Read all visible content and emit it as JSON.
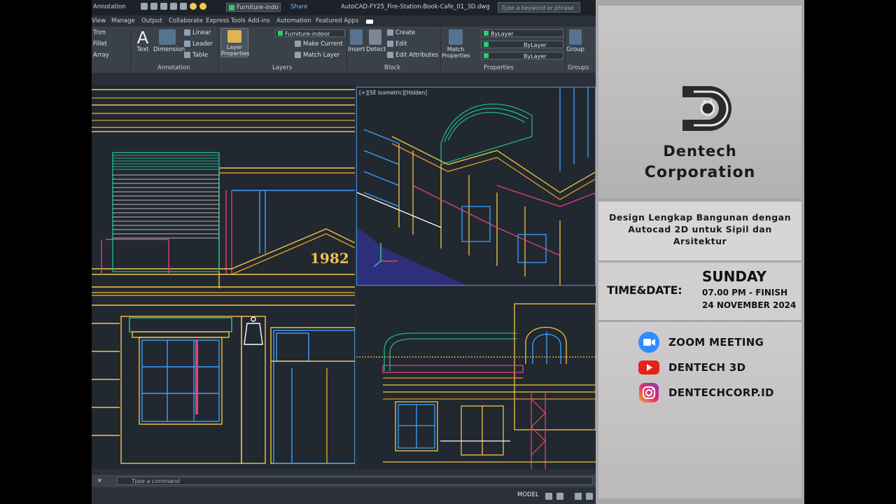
{
  "autocad": {
    "workspace": "Annotation",
    "quick_layer": "Furniture-indo",
    "share_label": "Share",
    "file_title": "AutoCAD-FY25_Fire-Station-Book-Cafe_01_3D.dwg",
    "search_placeholder": "Type a keyword or phrase",
    "tabs": [
      "View",
      "Manage",
      "Output",
      "Collaborate",
      "Express Tools",
      "Add-ins",
      "Automation",
      "Featured Apps"
    ],
    "ribbon": {
      "modify_items": [
        "Trim",
        "Fillet",
        "Array"
      ],
      "annotation_big": [
        "Text",
        "Dimension"
      ],
      "annotation_small": [
        "Linear",
        "Leader",
        "Table"
      ],
      "annotation_label": "Annotation",
      "layer_props": "Layer Properties",
      "layer_current": "Furniture-indoor",
      "layer_tools": [
        "Make Current",
        "Match Layer"
      ],
      "layers_label": "Layers",
      "insert_label": "Insert",
      "detect_label": "Detect",
      "block_tools": [
        "Create",
        "Edit",
        "Edit Attributes"
      ],
      "block_label": "Block",
      "match_props": "Match Properties",
      "bylayer": [
        "ByLayer",
        "ByLayer",
        "ByLayer"
      ],
      "properties_label": "Properties",
      "group_label": "Group",
      "groups_label": "Groups"
    },
    "viewport_label": "[+][SE Isometric][Hidden]",
    "building_year": "1982",
    "command_placeholder": "Type a command",
    "status_model": "MODEL"
  },
  "promo": {
    "company_line1": "Dentech",
    "company_line2": "Corporation",
    "course_title": "Design Lengkap Bangunan dengan Autocad 2D untuk Sipil dan Arsitektur",
    "time_date_label": "TIME&DATE:",
    "day": "SUNDAY",
    "time": "07.00 PM - FINISH",
    "date": "24 NOVEMBER 2024",
    "channels": [
      {
        "icon": "zoom-icon",
        "label": "ZOOM MEETING"
      },
      {
        "icon": "youtube-icon",
        "label": "DENTECH 3D"
      },
      {
        "icon": "instagram-icon",
        "label": "DENTECHCORP.ID"
      }
    ]
  }
}
